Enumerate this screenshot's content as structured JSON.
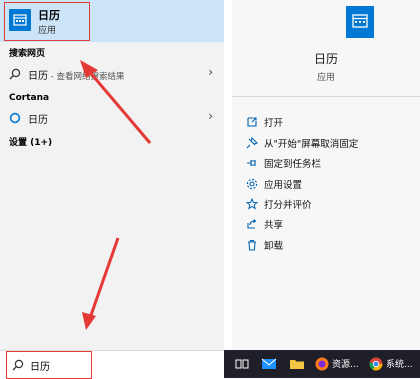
{
  "best_match": {
    "title": "日历",
    "subtitle": "应用"
  },
  "sections": {
    "web": {
      "heading": "搜索网页",
      "query": "日历",
      "suffix": " - 查看网络搜索结果"
    },
    "cortana": {
      "heading": "Cortana",
      "item": "日历"
    },
    "settings": {
      "heading": "设置 (1+)"
    }
  },
  "search_box": {
    "value": "日历"
  },
  "preview": {
    "title": "日历",
    "subtitle": "应用",
    "actions": [
      {
        "label": "打开",
        "icon": "open-icon"
      },
      {
        "label": "从\"开始\"屏幕取消固定",
        "icon": "unpin-icon"
      },
      {
        "label": "固定到任务栏",
        "icon": "pin-icon"
      },
      {
        "label": "应用设置",
        "icon": "gear-icon"
      },
      {
        "label": "打分并评价",
        "icon": "star-icon"
      },
      {
        "label": "共享",
        "icon": "share-icon"
      },
      {
        "label": "卸载",
        "icon": "trash-icon"
      }
    ]
  },
  "taskbar": {
    "items": [
      {
        "icon": "task-view-icon"
      },
      {
        "icon": "mail-icon"
      },
      {
        "icon": "folder-icon"
      },
      {
        "icon": "firefox-icon",
        "label": "资源..."
      },
      {
        "icon": "chrome-icon",
        "label": "系统..."
      }
    ]
  },
  "colors": {
    "accent": "#0078d4",
    "highlight": "#cce4f7",
    "annotation": "#e53935",
    "taskbar": "#1f1f2a"
  }
}
